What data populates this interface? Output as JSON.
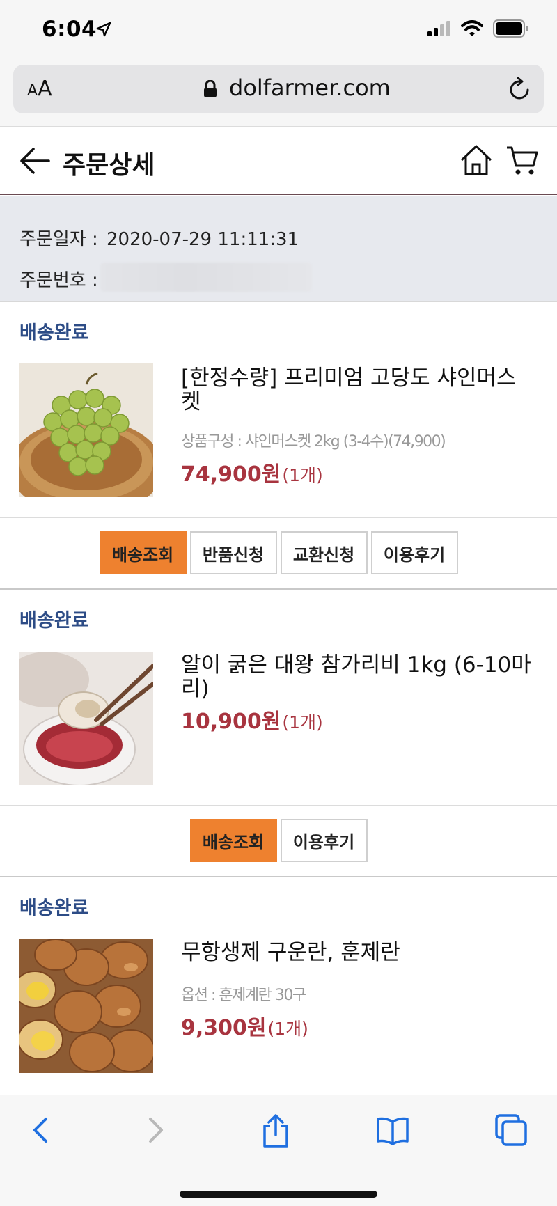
{
  "status_bar": {
    "time": "6:04"
  },
  "browser": {
    "aa_label_small": "A",
    "aa_label_big": "A",
    "url": "dolfarmer.com"
  },
  "header": {
    "title": "주문상세"
  },
  "order": {
    "date_label": "주문일자 :",
    "date_value": "2020-07-29 11:11:31",
    "number_label": "주문번호 :"
  },
  "products": [
    {
      "status": "배송완료",
      "name": "[한정수량] 프리미엄 고당도 샤인머스켓",
      "option": "상품구성 : 샤인머스켓 2kg (3-4수)(74,900)",
      "price": "74,900원",
      "qty": "(1개)",
      "buttons": [
        "배송조회",
        "반품신청",
        "교환신청",
        "이용후기"
      ]
    },
    {
      "status": "배송완료",
      "name": "알이 굵은 대왕 참가리비 1kg (6-10마리)",
      "option": "",
      "price": "10,900원",
      "qty": "(1개)",
      "buttons": [
        "배송조회",
        "이용후기"
      ]
    },
    {
      "status": "배송완료",
      "name": "무항생제 구운란, 훈제란",
      "option": "옵션 : 훈제계란 30구",
      "price": "9,300원",
      "qty": "(1개)",
      "buttons": []
    }
  ],
  "colors": {
    "accent": "#ee812f",
    "status": "#2d4c86",
    "price": "#a8343f",
    "info_bg": "#e7e9ee"
  }
}
